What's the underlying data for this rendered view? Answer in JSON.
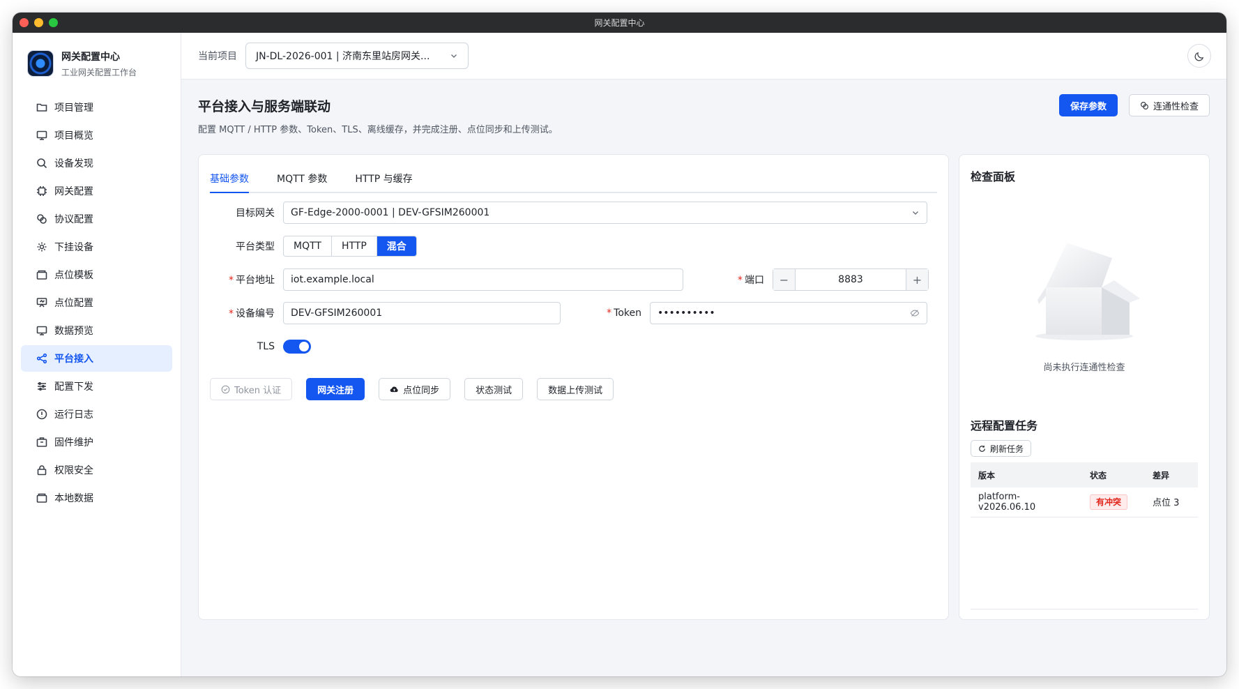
{
  "window": {
    "title": "网关配置中心"
  },
  "brand": {
    "name": "网关配置中心",
    "subtitle": "工业网关配置工作台"
  },
  "sidebar": {
    "items": [
      {
        "label": "项目管理",
        "icon": "folder-icon"
      },
      {
        "label": "项目概览",
        "icon": "monitor-icon"
      },
      {
        "label": "设备发现",
        "icon": "search-icon"
      },
      {
        "label": "网关配置",
        "icon": "chip-icon"
      },
      {
        "label": "协议配置",
        "icon": "link-icon"
      },
      {
        "label": "下挂设备",
        "icon": "gear-icon"
      },
      {
        "label": "点位模板",
        "icon": "box-icon"
      },
      {
        "label": "点位配置",
        "icon": "presentation-icon"
      },
      {
        "label": "数据预览",
        "icon": "monitor-icon"
      },
      {
        "label": "平台接入",
        "icon": "share-icon",
        "active": true
      },
      {
        "label": "配置下发",
        "icon": "sliders-icon"
      },
      {
        "label": "运行日志",
        "icon": "alert-icon"
      },
      {
        "label": "固件维护",
        "icon": "package-icon"
      },
      {
        "label": "权限安全",
        "icon": "lock-icon"
      },
      {
        "label": "本地数据",
        "icon": "box-icon"
      }
    ]
  },
  "topbar": {
    "project_label": "当前项目",
    "project_value": "JN-DL-2026-001 | 济南东里站房网关..."
  },
  "page": {
    "title": "平台接入与服务端联动",
    "description": "配置 MQTT / HTTP 参数、Token、TLS、离线缓存，并完成注册、点位同步和上传测试。",
    "save_button": "保存参数",
    "check_button": "连通性检查"
  },
  "tabs": [
    "基础参数",
    "MQTT 参数",
    "HTTP 与缓存"
  ],
  "form": {
    "gateway_label": "目标网关",
    "gateway_value": "GF-Edge-2000-0001 | DEV-GFSIM260001",
    "platform_type_label": "平台类型",
    "platform_types": [
      "MQTT",
      "HTTP",
      "混合"
    ],
    "platform_type_selected": "混合",
    "address_label": "平台地址",
    "address_value": "iot.example.local",
    "port_label": "端口",
    "port_value": "8883",
    "device_id_label": "设备编号",
    "device_id_value": "DEV-GFSIM260001",
    "token_label": "Token",
    "token_value": "••••••••••",
    "tls_label": "TLS",
    "tls_enabled": true
  },
  "actions": {
    "token_auth": "Token 认证",
    "register": "网关注册",
    "point_sync": "点位同步",
    "status_test": "状态测试",
    "upload_test": "数据上传测试"
  },
  "check_panel": {
    "title": "检查面板",
    "empty_text": "尚未执行连通性检查"
  },
  "tasks": {
    "title": "远程配置任务",
    "refresh_button": "刷新任务",
    "columns": [
      "版本",
      "状态",
      "差异"
    ],
    "rows": [
      {
        "version": "platform-v2026.06.10",
        "status": "有冲突",
        "diff": "点位 3"
      }
    ]
  },
  "colors": {
    "accent": "#1456f0",
    "danger": "#e1251b",
    "active_bg": "#e6efff"
  }
}
